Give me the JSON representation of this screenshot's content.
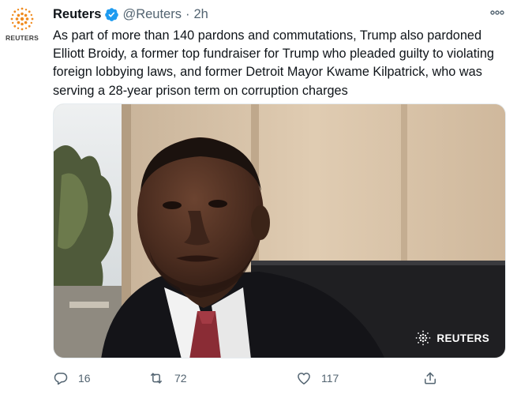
{
  "author": {
    "name": "Reuters",
    "handle": "@Reuters",
    "separator": "·",
    "time": "2h",
    "avatar_word": "REUTERS"
  },
  "tweet": {
    "text": "As part of more than 140 pardons and commutations, Trump also pardoned Elliott Broidy, a former top fundraiser for Trump who pleaded guilty to violating foreign lobbying laws, and former Detroit Mayor Kwame Kilpatrick, who was serving a 28-year prison term on corruption charges"
  },
  "media": {
    "watermark_word": "REUTERS"
  },
  "actions": {
    "replies": "16",
    "retweets": "72",
    "likes": "117"
  },
  "icons": {
    "verified": "verified-badge-icon",
    "more": "more-options-icon",
    "reply": "reply-icon",
    "retweet": "retweet-icon",
    "like": "heart-icon",
    "share": "share-icon"
  },
  "colors": {
    "verified_blue": "#1d9bf0",
    "icon_gray": "#536471",
    "reuters_orange": "#f08b1f"
  }
}
